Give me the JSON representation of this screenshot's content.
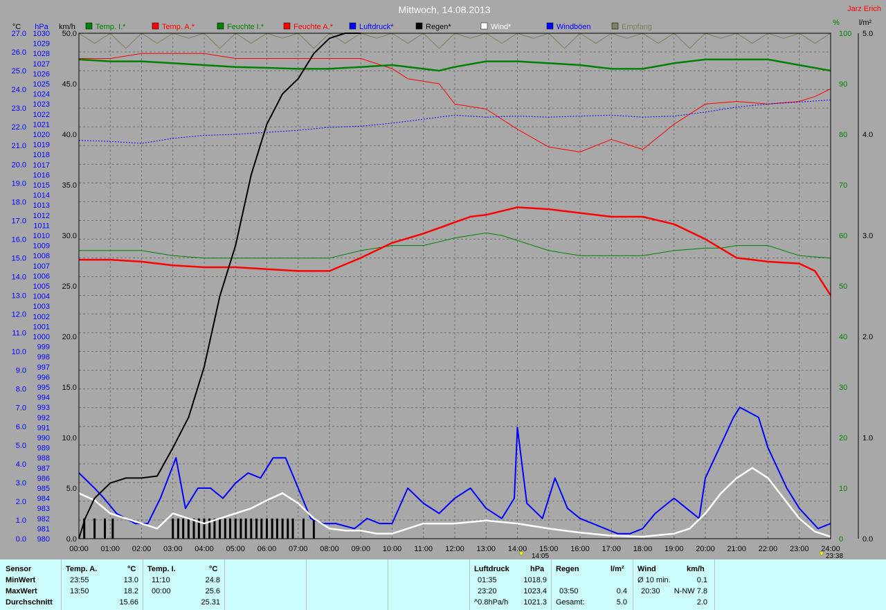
{
  "header": {
    "title": "Mittwoch, 14.08.2013",
    "author": "Jarz Erich",
    "unit_left_temp": "°C",
    "unit_left_press": "hPa",
    "unit_left_wind": "km/h",
    "unit_right_pct": "%",
    "unit_right_rain": "l/m²"
  },
  "legend": [
    {
      "label": "Temp. I.*",
      "color": "#008000"
    },
    {
      "label": "Temp. A.*",
      "color": "#ff0000"
    },
    {
      "label": "Feuchte I.*",
      "color": "#008000"
    },
    {
      "label": "Feuchte A.*",
      "color": "#ff0000"
    },
    {
      "label": "Luftdruck*",
      "color": "#0000ff"
    },
    {
      "label": "Regen*",
      "color": "#000000"
    },
    {
      "label": "Wind*",
      "color": "#ffffff"
    },
    {
      "label": "Windböen",
      "color": "#0000ff"
    },
    {
      "label": "Empfang",
      "color": "#808060"
    }
  ],
  "markers": {
    "left": "14:05",
    "right": "23:38"
  },
  "chart_data": {
    "type": "line",
    "x_unit": "hours",
    "x_ticks": [
      "00:00",
      "01:00",
      "02:00",
      "03:00",
      "04:00",
      "05:00",
      "06:00",
      "07:00",
      "08:00",
      "09:00",
      "10:00",
      "11:00",
      "12:00",
      "13:00",
      "14:00",
      "15:00",
      "16:00",
      "17:00",
      "18:00",
      "19:00",
      "20:00",
      "21:00",
      "22:00",
      "23:00",
      "24:00"
    ],
    "axes": {
      "temp_c": {
        "min": 0.0,
        "max": 27.0,
        "ticks": [
          "0.0",
          "1.0",
          "2.0",
          "3.0",
          "4.0",
          "5.0",
          "6.0",
          "7.0",
          "8.0",
          "9.0",
          "10.0",
          "11.0",
          "12.0",
          "13.0",
          "14.0",
          "15.0",
          "16.0",
          "17.0",
          "18.0",
          "19.0",
          "20.0",
          "21.0",
          "22.0",
          "23.0",
          "24.0",
          "25.0",
          "26.0",
          "27.0"
        ]
      },
      "pressure_hpa": {
        "min": 980,
        "max": 1030
      },
      "wind_kmh": {
        "min": 0.0,
        "max": 50.0,
        "ticks": [
          "0.0",
          "5.0",
          "10.0",
          "15.0",
          "20.0",
          "25.0",
          "30.0",
          "35.0",
          "40.0",
          "45.0",
          "50.0"
        ]
      },
      "humidity_pct": {
        "min": 0,
        "max": 100,
        "ticks": [
          "0",
          "10",
          "20",
          "30",
          "40",
          "50",
          "60",
          "70",
          "80",
          "90",
          "100"
        ]
      },
      "rain_lm2": {
        "min": 0.0,
        "max": 5.0,
        "ticks": [
          "0.0",
          "1.0",
          "2.0",
          "3.0",
          "4.0",
          "5.0"
        ]
      }
    },
    "series": [
      {
        "name": "Temp. I.*",
        "axis": "temp_c",
        "color": "#008000",
        "width": 2.5,
        "x": [
          0,
          1,
          2,
          3,
          4,
          5,
          6,
          7,
          8,
          9,
          10,
          11,
          11.5,
          12,
          13,
          14,
          15,
          16,
          17,
          18,
          19,
          20,
          21,
          22,
          23,
          24
        ],
        "y": [
          25.6,
          25.5,
          25.5,
          25.4,
          25.3,
          25.2,
          25.15,
          25.1,
          25.1,
          25.2,
          25.3,
          25.1,
          25.0,
          25.2,
          25.5,
          25.5,
          25.4,
          25.3,
          25.1,
          25.1,
          25.4,
          25.6,
          25.6,
          25.6,
          25.3,
          25.0
        ]
      },
      {
        "name": "Temp. A.*",
        "axis": "temp_c",
        "color": "#ff0000",
        "width": 2.5,
        "x": [
          0,
          1,
          2,
          3,
          4,
          5,
          6,
          7,
          8,
          9,
          10,
          11,
          12,
          12.5,
          13,
          14,
          15,
          16,
          17,
          18,
          19,
          20,
          21,
          22,
          23,
          23.5,
          24
        ],
        "y": [
          14.9,
          14.9,
          14.8,
          14.6,
          14.5,
          14.5,
          14.4,
          14.3,
          14.3,
          15.0,
          15.8,
          16.3,
          16.9,
          17.2,
          17.3,
          17.7,
          17.6,
          17.4,
          17.2,
          17.2,
          16.8,
          16.0,
          15.0,
          14.8,
          14.7,
          14.3,
          13.0
        ]
      },
      {
        "name": "Feuchte I.*",
        "axis": "humidity_pct",
        "color": "#008000",
        "width": 1,
        "x": [
          0,
          1,
          2,
          3,
          4,
          5,
          6,
          7,
          7.5,
          8,
          9,
          10,
          11,
          12,
          12.5,
          13,
          13.5,
          14,
          15,
          16,
          17,
          18,
          19,
          20,
          20.5,
          21,
          22,
          23,
          24
        ],
        "y": [
          57,
          57,
          57,
          56,
          55.5,
          55.5,
          55.5,
          55.5,
          55.5,
          55.5,
          57,
          58,
          58,
          59.5,
          60,
          60.5,
          60,
          59,
          57,
          56,
          56,
          56,
          57,
          57.5,
          57.5,
          58,
          58,
          56,
          55.5
        ]
      },
      {
        "name": "Feuchte A.*",
        "axis": "humidity_pct",
        "color": "#ff0000",
        "width": 1,
        "x": [
          0,
          1,
          2,
          3,
          4,
          5,
          6,
          7,
          8,
          9,
          10,
          10.5,
          11,
          11.5,
          12,
          13,
          14,
          15,
          16,
          17,
          18,
          19,
          20,
          21,
          22,
          23,
          23.5,
          24
        ],
        "y": [
          95,
          95,
          96,
          96,
          96,
          95,
          95,
          95,
          95,
          95,
          93,
          91,
          90.5,
          90,
          86,
          85,
          81,
          77.5,
          76.5,
          79,
          77,
          82,
          86,
          86.5,
          86,
          86.5,
          87.5,
          89
        ]
      },
      {
        "name": "Luftdruck*",
        "axis": "pressure_hpa",
        "color": "#0000ff",
        "width": 1,
        "dash": "2,2",
        "x": [
          0,
          1,
          2,
          3,
          4,
          5,
          6,
          7,
          8,
          9,
          10,
          11,
          12,
          13,
          14,
          15,
          16,
          17,
          18,
          19,
          20,
          21,
          22,
          23,
          24
        ],
        "y": [
          1019.4,
          1019.3,
          1019.1,
          1019.6,
          1019.9,
          1020.0,
          1020.2,
          1020.4,
          1020.7,
          1020.8,
          1021.1,
          1021.5,
          1021.9,
          1021.7,
          1021.8,
          1021.7,
          1021.8,
          1021.9,
          1021.7,
          1021.8,
          1022.2,
          1022.7,
          1023.0,
          1023.2,
          1023.4
        ]
      },
      {
        "name": "Regen*",
        "axis": "rain_lm2",
        "color": "#000000",
        "width": 2,
        "x": [
          0,
          0.2,
          0.5,
          1,
          1.5,
          2,
          2.5,
          3,
          3.5,
          4,
          4.5,
          5,
          5.5,
          6,
          6.5,
          7,
          7.5,
          8,
          8.5,
          9
        ],
        "y": [
          0,
          0.2,
          0.4,
          0.55,
          0.6,
          0.6,
          0.62,
          0.9,
          1.2,
          1.7,
          2.4,
          2.9,
          3.6,
          4.1,
          4.4,
          4.55,
          4.8,
          4.95,
          5.0,
          5.0
        ]
      },
      {
        "name": "Wind*",
        "axis": "wind_kmh",
        "color": "#ffffff",
        "width": 2.5,
        "x": [
          0,
          0.5,
          1,
          1.5,
          2,
          2.5,
          3,
          3.5,
          4,
          4.5,
          5,
          5.5,
          6,
          6.5,
          7,
          7.5,
          8,
          8.5,
          9,
          9.5,
          10,
          11,
          12,
          13,
          14,
          15,
          16,
          17,
          18,
          19,
          19.5,
          20,
          20.5,
          21,
          21.5,
          22,
          22.5,
          23,
          23.5,
          24
        ],
        "y": [
          4.5,
          3.8,
          2.5,
          2.0,
          1.5,
          1.0,
          2.5,
          2.0,
          1.5,
          2.0,
          2.5,
          3.0,
          3.8,
          4.5,
          3.5,
          2.0,
          1.0,
          0.8,
          0.8,
          0.5,
          0.5,
          1.5,
          1.5,
          1.8,
          1.5,
          1.0,
          0.6,
          0.3,
          0.2,
          0.5,
          1.0,
          2.5,
          4.5,
          6.0,
          7.0,
          6.0,
          4.0,
          2.0,
          0.7,
          0.2
        ]
      },
      {
        "name": "Windböen",
        "axis": "wind_kmh",
        "color": "#0000ff",
        "width": 2,
        "x": [
          0,
          0.5,
          0.8,
          1.2,
          1.8,
          2.2,
          2.6,
          3.1,
          3.4,
          3.8,
          4.2,
          4.6,
          5,
          5.4,
          5.8,
          6.2,
          6.6,
          7,
          7.4,
          7.8,
          8.2,
          8.8,
          9.2,
          9.6,
          10,
          10.5,
          11,
          11.5,
          12,
          12.5,
          13,
          13.5,
          13.9,
          14,
          14.3,
          14.8,
          15.2,
          15.6,
          16,
          16.4,
          16.8,
          17.2,
          17.6,
          18,
          18.4,
          18.8,
          19,
          19.4,
          19.8,
          20,
          20.3,
          20.6,
          20.9,
          21.1,
          21.4,
          21.7,
          22,
          22.3,
          22.6,
          23,
          23.3,
          23.6,
          24
        ],
        "y": [
          6.5,
          5.0,
          4.0,
          2.5,
          1.5,
          1.5,
          4.0,
          8.0,
          3.0,
          5.0,
          5.0,
          4.0,
          5.5,
          6.5,
          6.0,
          8.0,
          8.0,
          5.0,
          2.0,
          1.5,
          1.5,
          1.0,
          2.0,
          1.5,
          1.5,
          5.0,
          3.5,
          2.5,
          4.0,
          5.0,
          3.0,
          2.0,
          4.0,
          11.0,
          3.5,
          2.0,
          6.0,
          3.0,
          2.0,
          1.5,
          1.0,
          0.5,
          0.5,
          1.0,
          2.5,
          3.5,
          4.0,
          3.0,
          2.0,
          6.0,
          8.0,
          10.0,
          12.0,
          13.0,
          12.5,
          12.0,
          9.0,
          7.0,
          5.0,
          3.0,
          2.0,
          1.0,
          1.5
        ]
      },
      {
        "name": "Empfang",
        "axis": "humidity_pct",
        "color": "#808060",
        "width": 1,
        "x": [
          0,
          0.5,
          1,
          1.5,
          2,
          2.5,
          3,
          3.5,
          4,
          4.5,
          5,
          5.5,
          6,
          6.5,
          7,
          7.5,
          8,
          8.5,
          9,
          9.5,
          10,
          10.5,
          11,
          11.5,
          12,
          12.5,
          13,
          13.5,
          14,
          14.5,
          15,
          15.5,
          16,
          16.5,
          17,
          17.5,
          18,
          18.5,
          19,
          19.5,
          20,
          20.5,
          21,
          21.5,
          22,
          22.5,
          23,
          23.5,
          24
        ],
        "y": [
          100,
          98,
          100,
          97,
          100,
          98,
          100,
          99,
          100,
          97,
          100,
          98,
          100,
          99,
          100,
          97,
          100,
          98,
          100,
          99,
          100,
          98,
          100,
          97,
          100,
          99,
          100,
          98,
          100,
          99,
          100,
          97,
          100,
          98,
          100,
          99,
          100,
          98,
          100,
          97,
          100,
          99,
          100,
          98,
          100,
          99,
          100,
          98,
          100
        ]
      }
    ],
    "rain_bars": {
      "name": "Regen",
      "color": "#000000",
      "x": [
        0.17,
        0.5,
        0.83,
        1.08,
        3.0,
        3.17,
        3.33,
        3.5,
        3.67,
        3.83,
        4.0,
        4.17,
        4.33,
        4.5,
        4.67,
        4.83,
        5.0,
        5.17,
        5.33,
        5.5,
        5.67,
        5.83,
        6.0,
        6.17,
        6.33,
        6.5,
        6.67,
        6.83,
        7.17,
        7.5
      ],
      "y": [
        0.2,
        0.2,
        0.2,
        0.2,
        0.2,
        0.2,
        0.2,
        0.2,
        0.2,
        0.2,
        0.2,
        0.2,
        0.2,
        0.2,
        0.2,
        0.2,
        0.2,
        0.2,
        0.2,
        0.2,
        0.2,
        0.2,
        0.2,
        0.2,
        0.2,
        0.2,
        0.2,
        0.2,
        0.2,
        0.2
      ]
    }
  },
  "stats": {
    "row_labels": [
      "Sensor",
      "MinWert",
      "MaxWert",
      "Durchschnitt"
    ],
    "temp_a": {
      "title": "Temp. A.",
      "unit": "°C",
      "min_time": "23:55",
      "min_val": "13.0",
      "max_time": "13:50",
      "max_val": "18.2",
      "avg": "15.66"
    },
    "temp_i": {
      "title": "Temp. I.",
      "unit": "°C",
      "min_time": "11:10",
      "min_val": "24.8",
      "max_time": "00:00",
      "max_val": "25.6",
      "avg": "25.31"
    },
    "luftdruck": {
      "title": "Luftdruck",
      "unit": "hPa",
      "min_time": "01:35",
      "min_val": "1018.9",
      "max_time": "23:20",
      "max_val": "1023.4",
      "trend": "^0.8hPa/h",
      "avg": "1021.3"
    },
    "regen": {
      "title": "Regen",
      "unit": "l/m²",
      "max_time": "03:50",
      "max_val": "0.4",
      "total_label": "Gesamt:",
      "total": "5.0"
    },
    "wind": {
      "title": "Wind",
      "unit": "km/h",
      "avg_label": "Ø 10 min.",
      "avg10": "0.1",
      "max_time": "20:30",
      "max_val": "N-NW 7.8",
      "avg": "2.0"
    }
  }
}
